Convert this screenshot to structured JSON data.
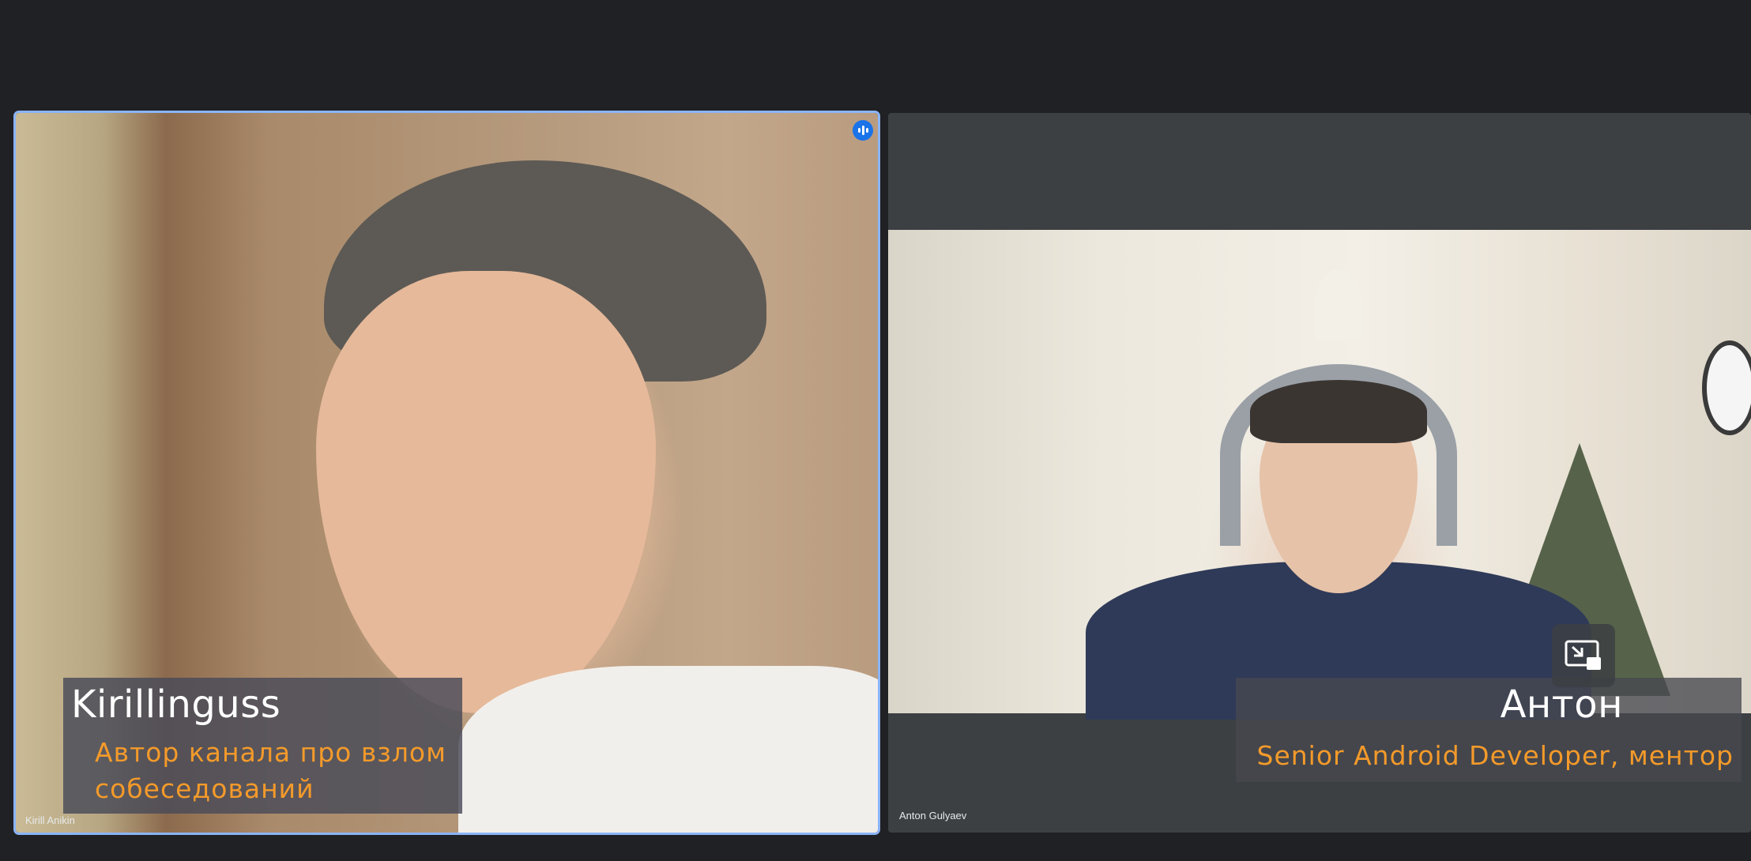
{
  "participants": [
    {
      "display_name": "Kirill Anikin",
      "overlay_name": "Kirillinguss",
      "overlay_role": "Автор канала про взлом собеседований",
      "is_speaking": true
    },
    {
      "display_name": "Anton Gulyaev",
      "overlay_name": "Антон",
      "overlay_role": "Senior Android Developer, ментор",
      "is_speaking": false
    }
  ],
  "controls": {
    "pip_icon": "picture-in-picture-icon",
    "speaking_icon": "audio-level-icon"
  },
  "colors": {
    "background": "#202124",
    "active_speaker_border": "#8ab4f8",
    "overlay_role_text": "#f49a2a",
    "speaking_badge": "#1a73e8"
  }
}
